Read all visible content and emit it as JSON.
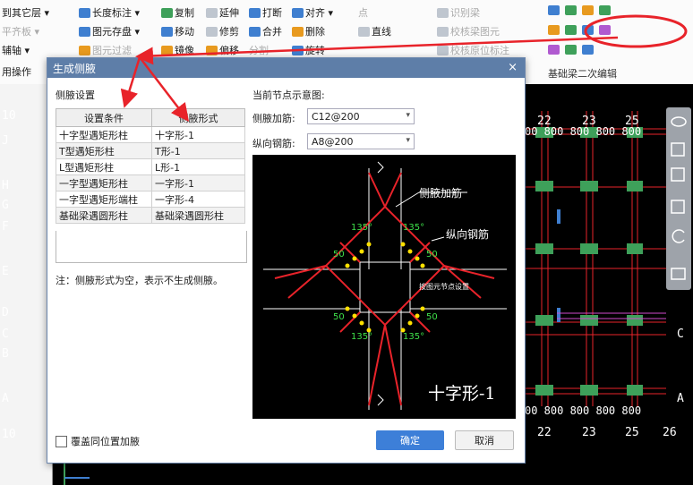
{
  "ribbon": {
    "row1": [
      "到其它层 ▾",
      "长度标注 ▾",
      "复制",
      "延伸",
      "打断",
      "对齐 ▾",
      "点",
      "识别梁"
    ],
    "row2": [
      "平齐板 ▾",
      "图元存盘 ▾",
      "移动",
      "修剪",
      "合并",
      "删除",
      "直线",
      "校核梁图元"
    ],
    "row3": [
      "辅轴 ▾",
      "图元过滤",
      "镜像",
      "偏移",
      "分割",
      "旋转",
      "校核原位标注"
    ],
    "row4": [
      "用操作"
    ],
    "group_label": "基础梁二次编辑"
  },
  "dialog": {
    "title": "生成侧腋",
    "close": "×",
    "left_section": "侧腋设置",
    "right_section": "当前节点示意图:",
    "table": {
      "headers": [
        "设置条件",
        "侧腋形式"
      ],
      "rows": [
        [
          "十字型遇矩形柱",
          "十字形-1"
        ],
        [
          "T型遇矩形柱",
          "T形-1"
        ],
        [
          "L型遇矩形柱",
          "L形-1"
        ],
        [
          "一字型遇矩形柱",
          "一字形-1"
        ],
        [
          "一字型遇矩形端柱",
          "一字形-4"
        ],
        [
          "基础梁遇圆形柱",
          "基础梁遇圆形柱"
        ]
      ]
    },
    "note": "注：侧腋形式为空，表示不生成侧腋。",
    "fields": {
      "side_rebar_label": "侧腋加筋:",
      "side_rebar_value": "C12@200",
      "long_rebar_label": "纵向钢筋:",
      "long_rebar_value": "A8@200"
    },
    "preview": {
      "label_side": "侧腋加筋",
      "label_long": "纵向钢筋",
      "angle": "135°",
      "dim": "50",
      "node_setting": "按图元节点设置",
      "caption": "十字形-1"
    },
    "checkbox_label": "覆盖同位置加腋",
    "ok": "确定",
    "cancel": "取消"
  },
  "cad": {
    "left_axes": [
      "10",
      "J",
      "H",
      "G",
      "F",
      "E",
      "D",
      "C",
      "B",
      "A",
      "10"
    ],
    "top_numbers": [
      "22",
      "23",
      "25"
    ],
    "top_dims": "00 800 800 800 800",
    "bottom_numbers": [
      "22",
      "23",
      "25",
      "26"
    ],
    "right_axes": [
      "C",
      "A"
    ]
  },
  "colors": {
    "accent": "#3d7fd8",
    "title": "#5e7ea8",
    "rebar": "#e8232a",
    "dots": "#ffe100"
  }
}
